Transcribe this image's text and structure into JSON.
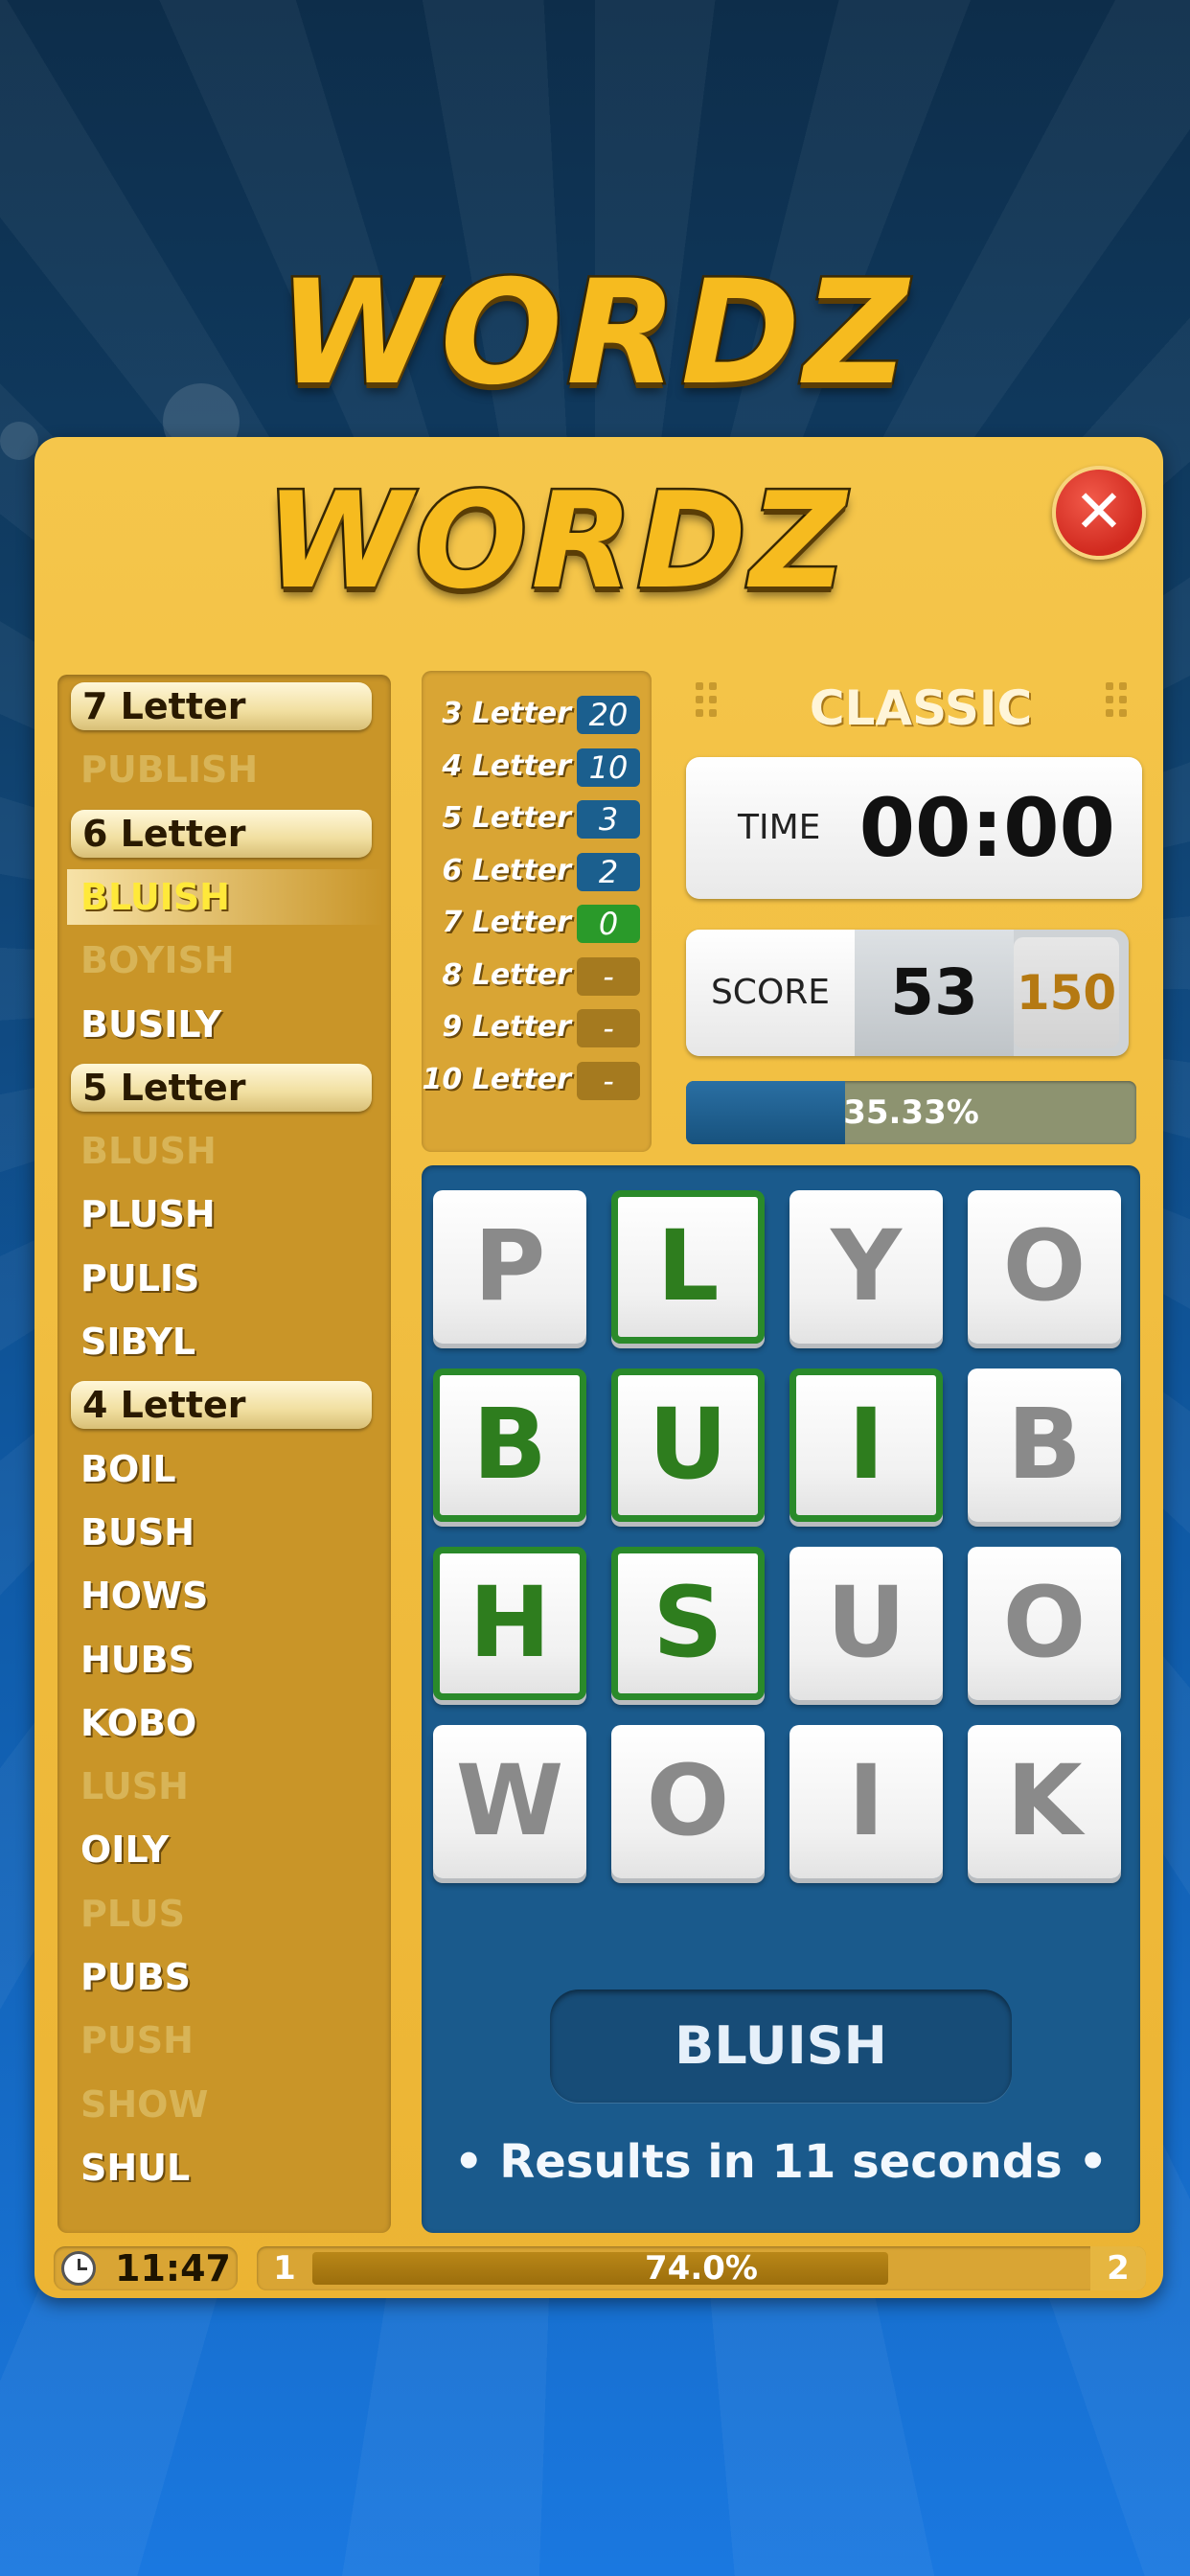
{
  "app": {
    "logo": "WORDZ"
  },
  "dialog": {
    "logo": "WORDZ",
    "close_symbol": "✕",
    "mode": "CLASSIC",
    "time_label": "TIME",
    "time_value": "00:00",
    "score_label": "SCORE",
    "score": "53",
    "max_score": "150",
    "progress_text": "35.33%",
    "progress_fraction": 0.3533
  },
  "word_list": [
    {
      "type": "header",
      "text": "7 Letter"
    },
    {
      "type": "word",
      "text": "PUBLISH",
      "status": "missed"
    },
    {
      "type": "header",
      "text": "6 Letter"
    },
    {
      "type": "word",
      "text": "BLUISH",
      "status": "current"
    },
    {
      "type": "word",
      "text": "BOYISH",
      "status": "missed"
    },
    {
      "type": "word",
      "text": "BUSILY",
      "status": "found"
    },
    {
      "type": "header",
      "text": "5 Letter"
    },
    {
      "type": "word",
      "text": "BLUSH",
      "status": "missed"
    },
    {
      "type": "word",
      "text": "PLUSH",
      "status": "found"
    },
    {
      "type": "word",
      "text": "PULIS",
      "status": "found"
    },
    {
      "type": "word",
      "text": "SIBYL",
      "status": "found"
    },
    {
      "type": "header",
      "text": "4 Letter"
    },
    {
      "type": "word",
      "text": "BOIL",
      "status": "found"
    },
    {
      "type": "word",
      "text": "BUSH",
      "status": "found"
    },
    {
      "type": "word",
      "text": "HOWS",
      "status": "found"
    },
    {
      "type": "word",
      "text": "HUBS",
      "status": "found"
    },
    {
      "type": "word",
      "text": "KOBO",
      "status": "found"
    },
    {
      "type": "word",
      "text": "LUSH",
      "status": "missed"
    },
    {
      "type": "word",
      "text": "OILY",
      "status": "found"
    },
    {
      "type": "word",
      "text": "PLUS",
      "status": "missed"
    },
    {
      "type": "word",
      "text": "PUBS",
      "status": "found"
    },
    {
      "type": "word",
      "text": "PUSH",
      "status": "missed"
    },
    {
      "type": "word",
      "text": "SHOW",
      "status": "missed"
    },
    {
      "type": "word",
      "text": "SHUL",
      "status": "found"
    }
  ],
  "letter_counts": [
    {
      "label": "3 Letter",
      "value": "20",
      "style": "blue"
    },
    {
      "label": "4 Letter",
      "value": "10",
      "style": "blue"
    },
    {
      "label": "5 Letter",
      "value": "3",
      "style": "blue"
    },
    {
      "label": "6 Letter",
      "value": "2",
      "style": "blue"
    },
    {
      "label": "7 Letter",
      "value": "0",
      "style": "green"
    },
    {
      "label": "8 Letter",
      "value": "-",
      "style": "none"
    },
    {
      "label": "9 Letter",
      "value": "-",
      "style": "none"
    },
    {
      "label": "10 Letter",
      "value": "-",
      "style": "none"
    }
  ],
  "board": {
    "tiles": [
      {
        "letter": "P",
        "selected": false
      },
      {
        "letter": "L",
        "selected": true
      },
      {
        "letter": "Y",
        "selected": false
      },
      {
        "letter": "O",
        "selected": false
      },
      {
        "letter": "B",
        "selected": true
      },
      {
        "letter": "U",
        "selected": true
      },
      {
        "letter": "I",
        "selected": true
      },
      {
        "letter": "B",
        "selected": false
      },
      {
        "letter": "H",
        "selected": true
      },
      {
        "letter": "S",
        "selected": true
      },
      {
        "letter": "U",
        "selected": false
      },
      {
        "letter": "O",
        "selected": false
      },
      {
        "letter": "W",
        "selected": false
      },
      {
        "letter": "O",
        "selected": false
      },
      {
        "letter": "I",
        "selected": false
      },
      {
        "letter": "K",
        "selected": false
      }
    ],
    "current_word": "BLUISH",
    "results_text": "• Results in 11 seconds •"
  },
  "footer": {
    "clock_icon": "clock-icon",
    "clock_time": "11:47",
    "level_start": "1",
    "level_end": "2",
    "level_progress_text": "74.0%",
    "level_progress_fraction": 0.74
  },
  "colors": {
    "panel": "#ecb433",
    "board": "#1a5a8c",
    "selected_tile": "#2a8a2a",
    "close_button": "#d12a1f"
  }
}
